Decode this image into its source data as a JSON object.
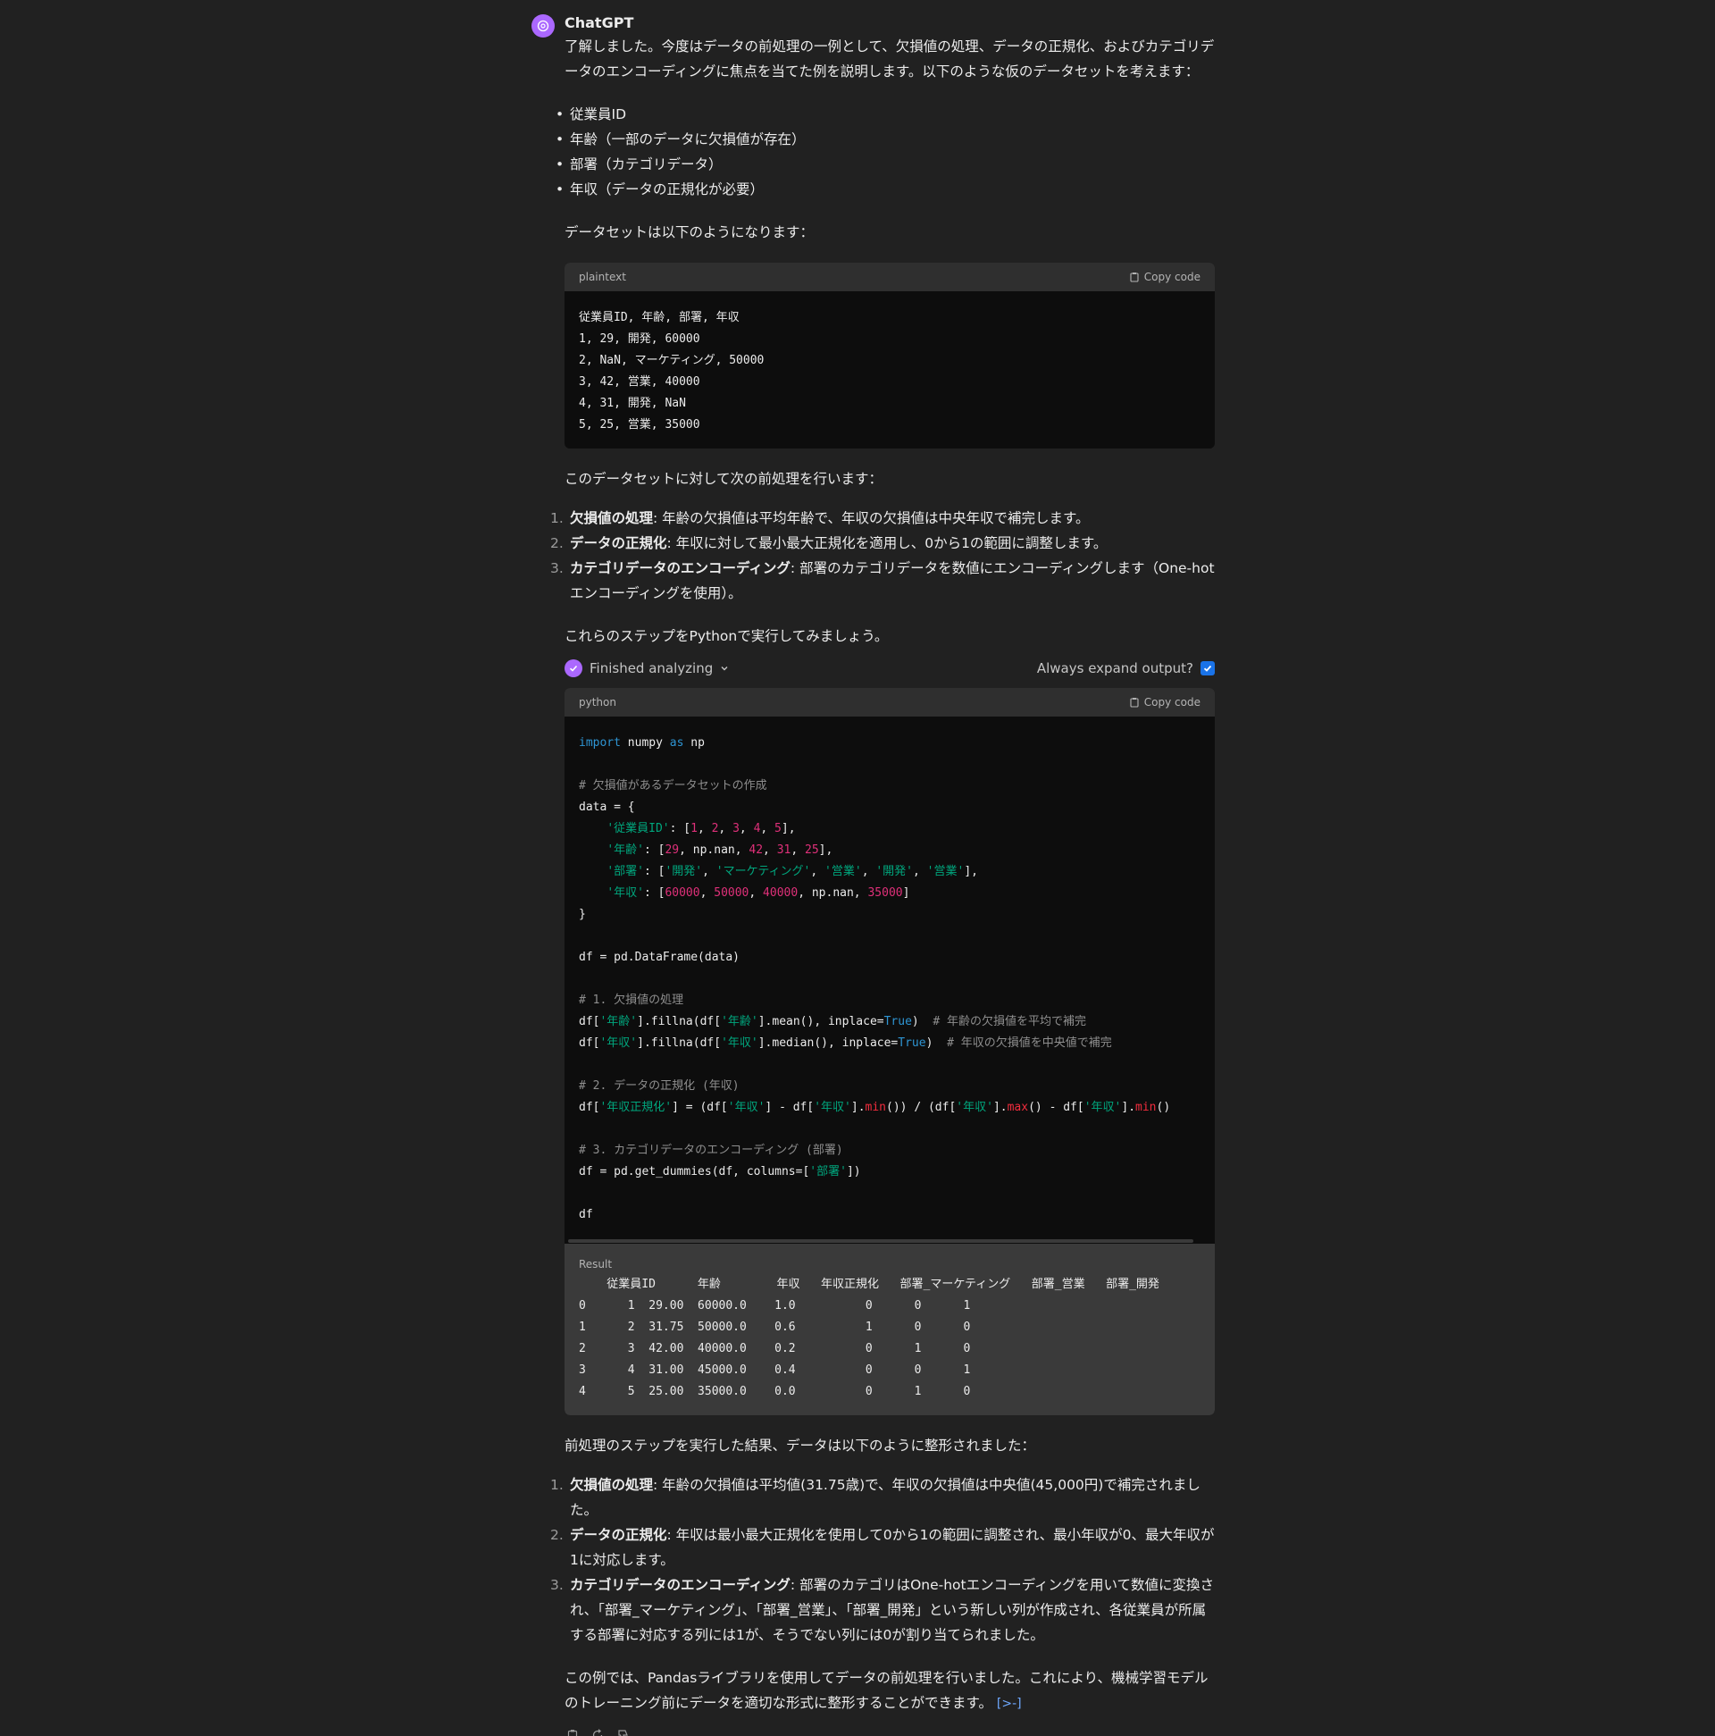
{
  "sender": "ChatGPT",
  "intro": "了解しました。今度はデータの前処理の一例として、欠損値の処理、データの正規化、およびカテゴリデータのエンコーディングに焦点を当てた例を説明します。以下のような仮のデータセットを考えます：",
  "bullets": [
    "従業員ID",
    "年齢（一部のデータに欠損値が存在）",
    "部署（カテゴリデータ）",
    "年収（データの正規化が必要）"
  ],
  "dataset_intro": "データセットは以下のようになります：",
  "plaintext_block": {
    "lang": "plaintext",
    "copy_label": "Copy code",
    "lines": [
      "従業員ID, 年齢, 部署, 年収",
      "1, 29, 開発, 60000",
      "2, NaN, マーケティング, 50000",
      "3, 42, 営業, 40000",
      "4, 31, 開発, NaN",
      "5, 25, 営業, 35000"
    ]
  },
  "steps_intro": "このデータセットに対して次の前処理を行います：",
  "steps": [
    {
      "num": "1.",
      "title": "欠損値の処理",
      "text": ": 年齢の欠損値は平均年齢で、年収の欠損値は中央年収で補完します。"
    },
    {
      "num": "2.",
      "title": "データの正規化",
      "text": ": 年収に対して最小最大正規化を適用し、0から1の範囲に調整します。"
    },
    {
      "num": "3.",
      "title": "カテゴリデータのエンコーディング",
      "text": ": 部署のカテゴリデータを数値にエンコーディングします（One-hotエンコーディングを使用）。"
    }
  ],
  "python_intro": "これらのステップをPythonで実行してみましょう。",
  "analysis": {
    "status": "Finished analyzing",
    "expand_label": "Always expand output?"
  },
  "python_block": {
    "lang": "python",
    "copy_label": "Copy code"
  },
  "result": {
    "label": "Result",
    "header": "    従業員ID      年齢        年収   年収正規化   部署_マーケティング   部署_営業   部署_開発",
    "rows": [
      "0      1  29.00  60000.0    1.0          0      0      1",
      "1      2  31.75  50000.0    0.6          1      0      0",
      "2      3  42.00  40000.0    0.2          0      1      0",
      "3      4  31.00  45000.0    0.4          0      0      1",
      "4      5  25.00  35000.0    0.0          0      1      0"
    ]
  },
  "summary_intro": "前処理のステップを実行した結果、データは以下のように整形されました：",
  "summary": [
    {
      "num": "1.",
      "title": "欠損値の処理",
      "text": ": 年齢の欠損値は平均値(31.75歳)で、年収の欠損値は中央値(45,000円)で補完されました。"
    },
    {
      "num": "2.",
      "title": "データの正規化",
      "text": ": 年収は最小最大正規化を使用して0から1の範囲に調整され、最小年収が0、最大年収が1に対応します。"
    },
    {
      "num": "3.",
      "title": "カテゴリデータのエンコーディング",
      "text": ": 部署のカテゴリはOne-hotエンコーディングを用いて数値に変換され、「部署_マーケティング」、「部署_営業」、「部署_開発」という新しい列が作成され、各従業員が所属する部署に対応する列には1が、そうでない列には0が割り当てられました。"
    }
  ],
  "conclusion": "この例では、Pandasライブラリを使用してデータの前処理を行いました。これにより、機械学習モデルのトレーニング前にデータを適切な形式に整形することができます。",
  "cite_label": "[>-]"
}
